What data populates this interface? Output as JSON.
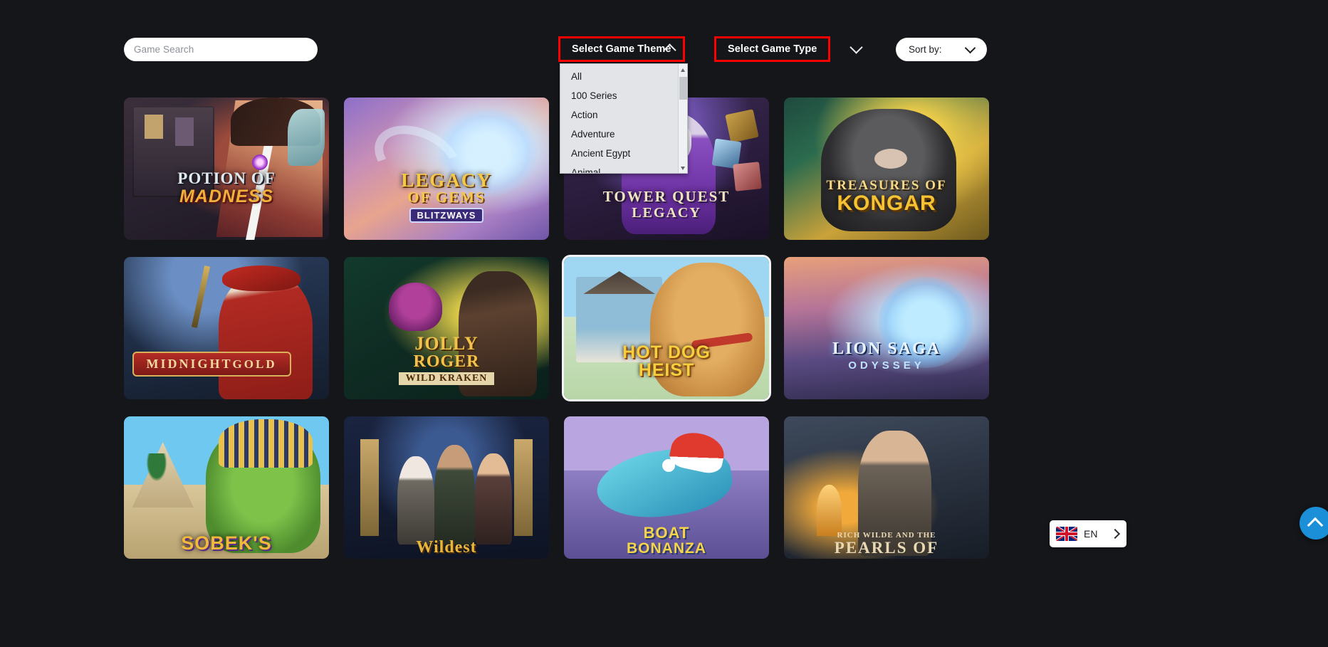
{
  "toolbar": {
    "search": {
      "placeholder": "Game Search"
    },
    "theme_filter": {
      "label": "Select Game Theme",
      "chevron": "chevron-up-icon",
      "expanded": true,
      "highlighted": true
    },
    "type_filter": {
      "label": "Select Game Type",
      "chevron": "chevron-down-icon",
      "expanded": false,
      "highlighted": true
    },
    "sort": {
      "label": "Sort by:",
      "chevron": "chevron-down-icon"
    },
    "highlight_color": "#ff0000"
  },
  "theme_dropdown": {
    "items": [
      "All",
      "100 Series",
      "Action",
      "Adventure",
      "Ancient Egypt",
      "Animal"
    ],
    "scrollbar": {
      "up_arrow": "scroll-up-arrow-icon",
      "down_arrow": "scroll-down-arrow-icon"
    }
  },
  "games": [
    [
      {
        "name": "Potion of Madness",
        "line1": "POTION OF",
        "line2": "MADNESS",
        "art": "a-potion",
        "lbl": "lbl-potion",
        "selected": false
      },
      {
        "name": "Legacy of Gems Blitzways",
        "line1": "LEGACY",
        "line2": "OF GEMS",
        "line3": "BLITZWAYS",
        "art": "a-legacy",
        "lbl": "lbl-legacy",
        "selected": false
      },
      {
        "name": "Tower Quest Legacy",
        "line1": "TOWER QUEST",
        "line2": "LEGACY",
        "art": "a-tower",
        "lbl": "lbl-tower",
        "selected": false
      },
      {
        "name": "Treasures of Kongar",
        "line1": "TREASURES OF",
        "line2": "KONGAR",
        "art": "a-kong",
        "lbl": "lbl-kong",
        "selected": false
      }
    ],
    [
      {
        "name": "Midnight Gold",
        "line1": "MIDNIGHT",
        "line2": "GOLD",
        "art": "a-mid",
        "lbl": "lbl-mid",
        "selected": false
      },
      {
        "name": "Jolly Roger Wild Kraken",
        "line1": "JOLLY",
        "line2": "ROGER",
        "line3": "WILD KRAKEN",
        "art": "a-jolly",
        "lbl": "lbl-jolly",
        "selected": false
      },
      {
        "name": "Hot Dog Heist",
        "line1": "HOT DOG",
        "line2": "HEIST",
        "art": "a-hotdog",
        "lbl": "lbl-hotdog",
        "selected": true
      },
      {
        "name": "Lion Saga Odyssey",
        "line1": "LION SAGA",
        "line2": "ODYSSEY",
        "art": "a-lion",
        "lbl": "lbl-lion",
        "selected": false
      }
    ],
    [
      {
        "name": "Sobek's",
        "line1": "SOBEK'S",
        "art": "a-sobek",
        "lbl": "lbl-sobek",
        "selected": false
      },
      {
        "name": "Wildest",
        "line1": "Wildest",
        "art": "a-wildest",
        "lbl": "lbl-wildest",
        "selected": false
      },
      {
        "name": "Boat Bonanza",
        "line1": "BOAT",
        "line2": "BONANZA",
        "art": "a-boat",
        "lbl": "lbl-boat",
        "selected": false
      },
      {
        "name": "Rich Wilde and the Pearls of",
        "line1": "RICH WILDE AND THE",
        "line2": "PEARLS OF",
        "art": "a-pearls",
        "lbl": "lbl-pearls",
        "selected": false
      }
    ]
  ],
  "language_widget": {
    "code": "EN",
    "flag": "uk-flag-icon",
    "arrow": "chevron-right-icon"
  },
  "scroll_top_button": {
    "icon": "chevron-up-icon",
    "color": "#1b8fd8"
  }
}
